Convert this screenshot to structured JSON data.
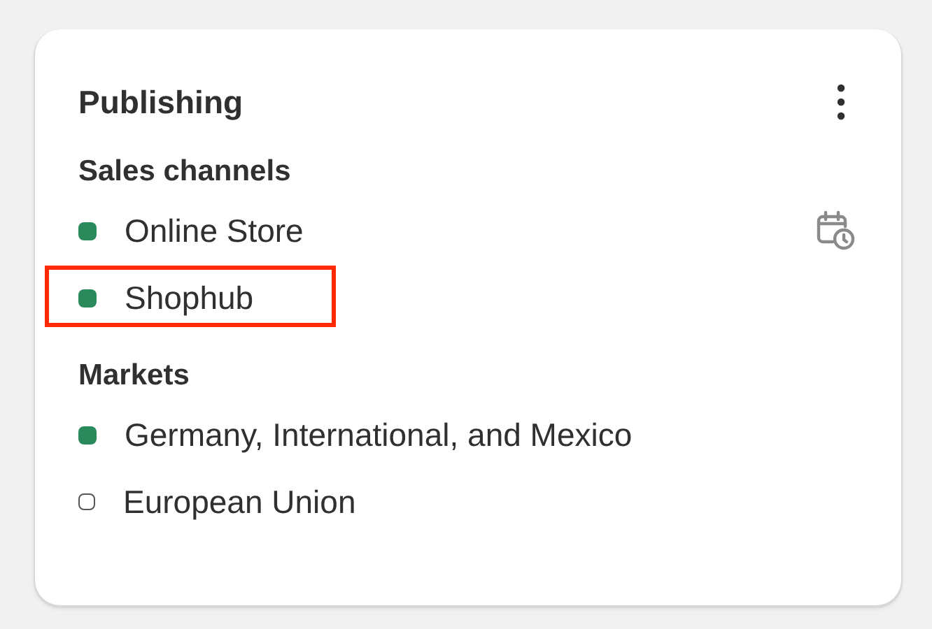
{
  "card": {
    "title": "Publishing"
  },
  "sections": [
    {
      "heading": "Sales channels",
      "items": [
        {
          "label": "Online Store",
          "active": true,
          "highlighted": false,
          "scheduled": true
        },
        {
          "label": "Shophub",
          "active": true,
          "highlighted": true,
          "scheduled": false
        }
      ]
    },
    {
      "heading": "Markets",
      "items": [
        {
          "label": "Germany, International, and Mexico",
          "active": true,
          "highlighted": false,
          "scheduled": false
        },
        {
          "label": "European Union",
          "active": false,
          "highlighted": false,
          "scheduled": false
        }
      ]
    }
  ]
}
